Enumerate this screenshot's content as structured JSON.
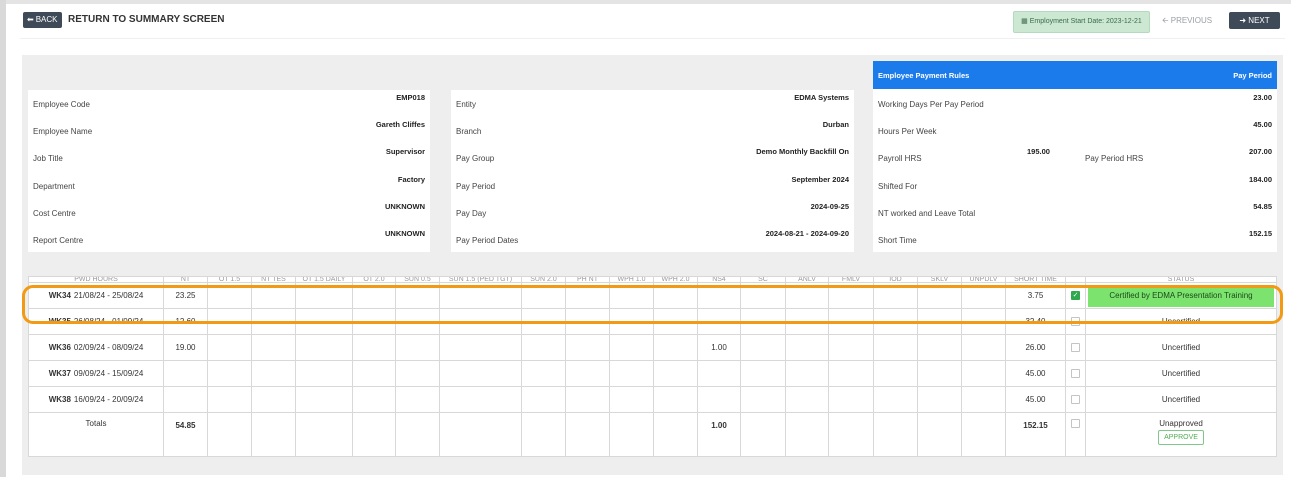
{
  "header": {
    "back_label": "BACK",
    "title": "RETURN TO SUMMARY SCREEN",
    "start_date": "Employment Start Date: 2023-12-21",
    "previous_label": "PREVIOUS",
    "next_label": "NEXT"
  },
  "employee": {
    "rows": [
      {
        "label": "Employee Code",
        "value": "EMP018"
      },
      {
        "label": "Employee Name",
        "value": "Gareth Cliffes"
      },
      {
        "label": "Job Title",
        "value": "Supervisor"
      },
      {
        "label": "Department",
        "value": "Factory"
      },
      {
        "label": "Cost Centre",
        "value": "UNKNOWN"
      },
      {
        "label": "Report Centre",
        "value": "UNKNOWN"
      }
    ]
  },
  "entity": {
    "rows": [
      {
        "label": "Entity",
        "value": "EDMA Systems"
      },
      {
        "label": "Branch",
        "value": "Durban"
      },
      {
        "label": "Pay Group",
        "value": "Demo Monthly Backfill On"
      },
      {
        "label": "Pay Period",
        "value": "September 2024"
      },
      {
        "label": "Pay Day",
        "value": "2024-09-25"
      },
      {
        "label": "Pay Period Dates",
        "value": "2024-08-21 - 2024-09-20"
      }
    ]
  },
  "rules": {
    "header_left": "Employee Payment Rules",
    "header_right": "Pay Period",
    "working_days_label": "Working Days Per Pay Period",
    "working_days_value": "23.00",
    "hours_per_week_label": "Hours Per Week",
    "hours_per_week_value": "45.00",
    "payroll_hrs_label": "Payroll HRS",
    "payroll_hrs_value": "195.00",
    "pay_period_hrs_label": "Pay Period HRS",
    "pay_period_hrs_value": "207.00",
    "shifted_for_label": "Shifted For",
    "shifted_for_value": "184.00",
    "nt_leave_label": "NT worked and Leave Total",
    "nt_leave_value": "54.85",
    "short_time_label": "Short Time",
    "short_time_value": "152.15"
  },
  "table": {
    "columns": [
      "PWD HOURS",
      "NT",
      "OT 1.5",
      "NT TES",
      "OT 1.5 DAILY",
      "OT 2.0",
      "SUN 0.5",
      "SUN 1.5 (PED TGT)",
      "SUN 2.0",
      "PH NT",
      "WPH 1.0",
      "WPH 2.0",
      "NS4",
      "SC",
      "ANLV",
      "FMLV",
      "IOD",
      "SKLV",
      "UNPDLV",
      "SHORT TIME",
      "",
      "STATUS"
    ],
    "rows": [
      {
        "week": "WK34",
        "dates": "21/08/24 - 25/08/24",
        "nt": "23.25",
        "ns4": "",
        "short_time": "3.75",
        "status": "Certified by EDMA Presentation Training"
      },
      {
        "week": "WK35",
        "dates": "26/08/24 - 01/09/24",
        "nt": "12.60",
        "ns4": "",
        "short_time": "32.40",
        "status": "Uncertified"
      },
      {
        "week": "WK36",
        "dates": "02/09/24 - 08/09/24",
        "nt": "19.00",
        "ns4": "1.00",
        "short_time": "26.00",
        "status": "Uncertified"
      },
      {
        "week": "WK37",
        "dates": "09/09/24 - 15/09/24",
        "nt": "",
        "ns4": "",
        "short_time": "45.00",
        "status": "Uncertified"
      },
      {
        "week": "WK38",
        "dates": "16/09/24 - 20/09/24",
        "nt": "",
        "ns4": "",
        "short_time": "45.00",
        "status": "Uncertified"
      }
    ],
    "totals": {
      "label": "Totals",
      "nt": "54.85",
      "ns4": "1.00",
      "short_time": "152.15",
      "status": "Unapproved",
      "approve_label": "APPROVE"
    }
  }
}
